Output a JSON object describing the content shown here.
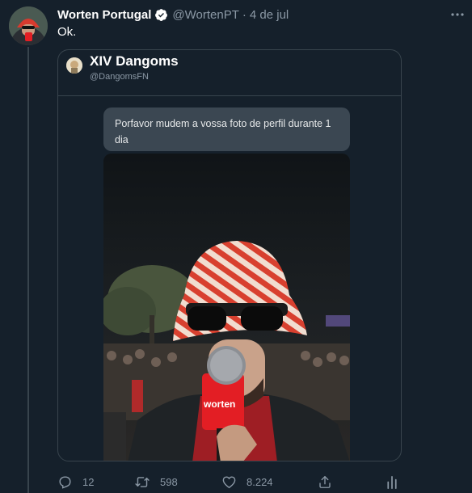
{
  "tweet": {
    "author_name": "Worten Portugal",
    "author_handle": "@WortenPT",
    "separator": "·",
    "date": "4 de jul",
    "text": "Ok."
  },
  "quoted_tweet": {
    "author_name": "XIV Dangoms",
    "author_handle": "@DangomsFN",
    "message": "Porfavor mudem a vossa foto de perfil durante 1 dia",
    "photo_brand_text": "worten"
  },
  "actions": {
    "reply_count": "12",
    "retweet_count": "598",
    "like_count": "8.224"
  },
  "icons": {
    "verified": "verified-badge-icon",
    "more": "more-options-icon",
    "reply": "reply-icon",
    "retweet": "retweet-icon",
    "like": "heart-icon",
    "share": "share-icon",
    "analytics": "analytics-icon"
  },
  "colors": {
    "background": "#15202b",
    "border": "#38444d",
    "secondary_text": "#8b98a5",
    "verified": "#1d9bf0",
    "brand_red": "#e31e24"
  }
}
